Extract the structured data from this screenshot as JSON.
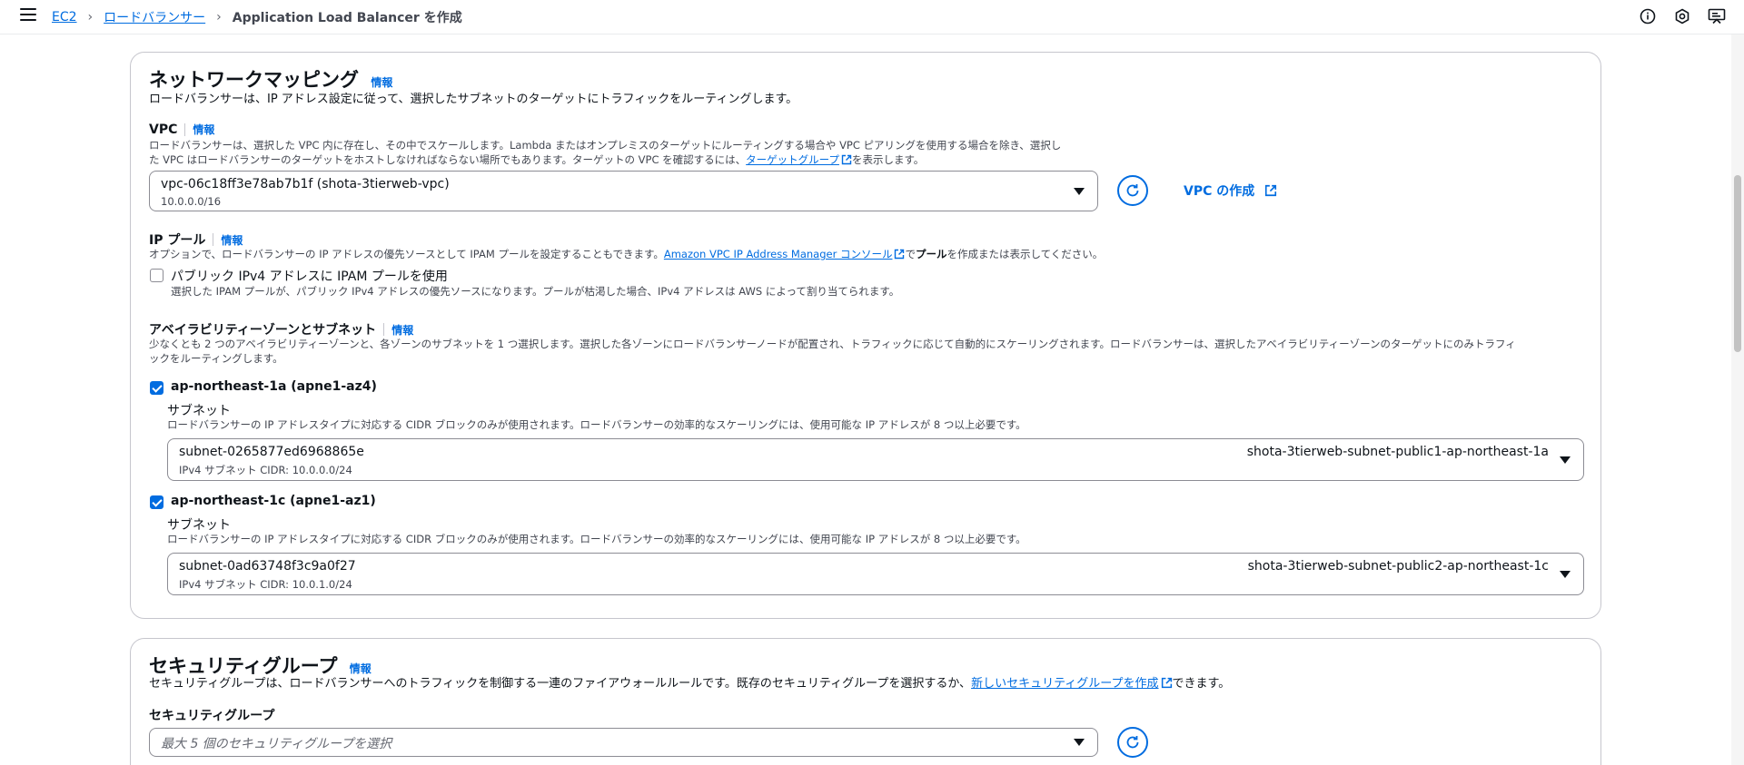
{
  "breadcrumb": {
    "items": [
      "EC2",
      "ロードバランサー"
    ],
    "current": "Application Load Balancer を作成"
  },
  "icons": {
    "menu": "menu-icon",
    "info": "info-icon",
    "settings": "settings-icon",
    "feedback": "feedback-icon"
  },
  "network": {
    "title": "ネットワークマッピング",
    "info": "情報",
    "description": "ロードバランサーは、IP アドレス設定に従って、選択したサブネットのターゲットにトラフィックをルーティングします。",
    "vpc": {
      "label": "VPC",
      "info": "情報",
      "desc_line1": "ロードバランサーは、選択した VPC 内に存在し、その中でスケールします。Lambda またはオンプレミスのターゲットにルーティングする場合や VPC ピアリングを使用する場合を除き、選択し",
      "desc_line2_pre": "た VPC はロードバランサーのターゲットをホストしなければならない場所でもあります。ターゲットの VPC を確認するには、",
      "desc_link": "ターゲットグループ",
      "desc_line2_post": "を表示します。",
      "selected": "vpc-06c18ff3e78ab7b1f (shota-3tierweb-vpc)",
      "cidr": "10.0.0.0/16",
      "create_label": "VPC の作成"
    },
    "ip_pool": {
      "label": "IP プール",
      "info": "情報",
      "desc_pre": "オプションで、ロードバランサーの IP アドレスの優先ソースとして IPAM プールを設定することもできます。",
      "desc_link": "Amazon VPC IP Address Manager コンソール",
      "desc_mid": "で",
      "desc_bold": "プール",
      "desc_post": "を作成または表示してください。",
      "checkbox_label": "パブリック IPv4 アドレスに IPAM プールを使用",
      "checkbox_desc": "選択した IPAM プールが、パブリック IPv4 アドレスの優先ソースになります。プールが枯渇した場合、IPv4 アドレスは AWS によって割り当てられます。",
      "checked": false
    },
    "az": {
      "label": "アベイラビリティーゾーンとサブネット",
      "info": "情報",
      "desc_line1": "少なくとも 2 つのアベイラビリティーゾーンと、各ゾーンのサブネットを 1 つ選択します。選択した各ゾーンにロードバランサーノードが配置され、トラフィックに応じて自動的にスケーリングされます。ロードバランサーは、選択したアベイラビリティーゾーンのターゲットにのみトラフィ",
      "desc_line2": "ックをルーティングします。",
      "zones": [
        {
          "name": "ap-northeast-1a (apne1-az4)",
          "checked": true,
          "subnet_label": "サブネット",
          "subnet_desc": "ロードバランサーの IP アドレスタイプに対応する CIDR ブロックのみが使用されます。ロードバランサーの効率的なスケーリングには、使用可能な IP アドレスが 8 つ以上必要です。",
          "subnet_id": "subnet-0265877ed6968865e",
          "subnet_cidr": "IPv4 サブネット CIDR: 10.0.0.0/24",
          "subnet_name": "shota-3tierweb-subnet-public1-ap-northeast-1a"
        },
        {
          "name": "ap-northeast-1c (apne1-az1)",
          "checked": true,
          "subnet_label": "サブネット",
          "subnet_desc": "ロードバランサーの IP アドレスタイプに対応する CIDR ブロックのみが使用されます。ロードバランサーの効率的なスケーリングには、使用可能な IP アドレスが 8 つ以上必要です。",
          "subnet_id": "subnet-0ad63748f3c9a0f27",
          "subnet_cidr": "IPv4 サブネット CIDR: 10.0.1.0/24",
          "subnet_name": "shota-3tierweb-subnet-public2-ap-northeast-1c"
        }
      ]
    }
  },
  "security": {
    "title": "セキュリティグループ",
    "info": "情報",
    "desc_pre": "セキュリティグループは、ロードバランサーへのトラフィックを制御する一連のファイアウォールルールです。既存のセキュリティグループを選択するか、",
    "desc_link": "新しいセキュリティグループを作成",
    "desc_post": "できます。",
    "label": "セキュリティグループ",
    "placeholder": "最大 5 個のセキュリティグループを選択"
  },
  "colors": {
    "link": "#006ce0",
    "text": "#0f141a",
    "muted": "#424650",
    "border": "#c6c6cd"
  }
}
